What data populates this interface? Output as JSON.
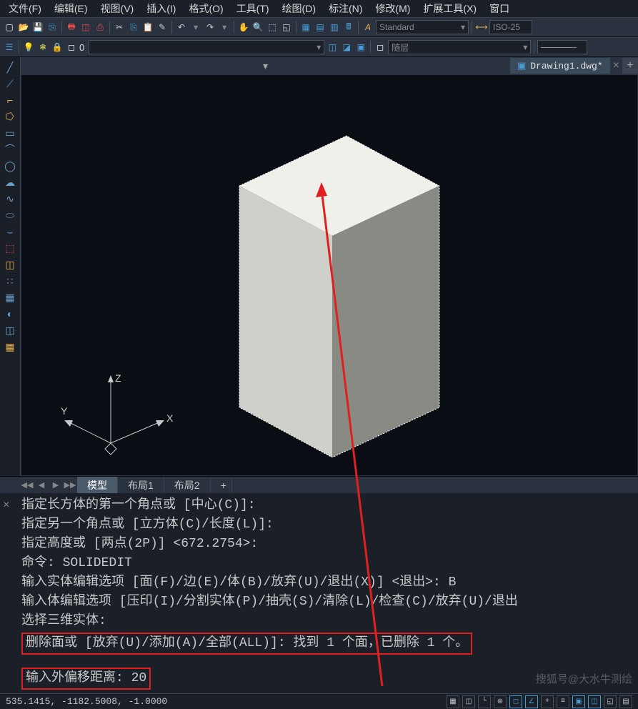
{
  "menu": {
    "items": [
      "文件(F)",
      "编辑(E)",
      "视图(V)",
      "插入(I)",
      "格式(O)",
      "工具(T)",
      "绘图(D)",
      "标注(N)",
      "修改(M)",
      "扩展工具(X)",
      "窗口"
    ]
  },
  "toolbar1": {
    "style_dd": "Standard",
    "dim_dd": "ISO-25"
  },
  "toolbar2": {
    "layer_num": "0",
    "layer_dd": "随层"
  },
  "tabs": {
    "dropdown_icon": "▾",
    "current": "Drawing1.dwg*"
  },
  "layout": {
    "tabs": [
      "模型",
      "布局1",
      "布局2"
    ],
    "plus": "+"
  },
  "command": {
    "lines": [
      "指定长方体的第一个角点或 [中心(C)]:",
      "指定另一个角点或 [立方体(C)/长度(L)]:",
      "指定高度或 [两点(2P)] <672.2754>:",
      "命令: SOLIDEDIT",
      "输入实体编辑选项 [面(F)/边(E)/体(B)/放弃(U)/退出(X)] <退出>: B",
      "输入体编辑选项 [压印(I)/分割实体(P)/抽壳(S)/清除(L)/检查(C)/放弃(U)/退出",
      "选择三维实体:"
    ],
    "hl1": "删除面或 [放弃(U)/添加(A)/全部(ALL)]: 找到 1 个面，已删除 1 个。",
    "hl2": "输入外偏移距离: 20"
  },
  "status": {
    "coords": "535.1415, -1182.5008, -1.0000"
  },
  "ucs": {
    "x": "X",
    "y": "Y",
    "z": "Z"
  },
  "watermark": "搜狐号@大水牛测绘",
  "icons": {
    "close": "×",
    "plus": "+",
    "tri_down": "▾",
    "first": "◀◀",
    "prev": "◀",
    "next": "▶",
    "last": "▶▶"
  }
}
